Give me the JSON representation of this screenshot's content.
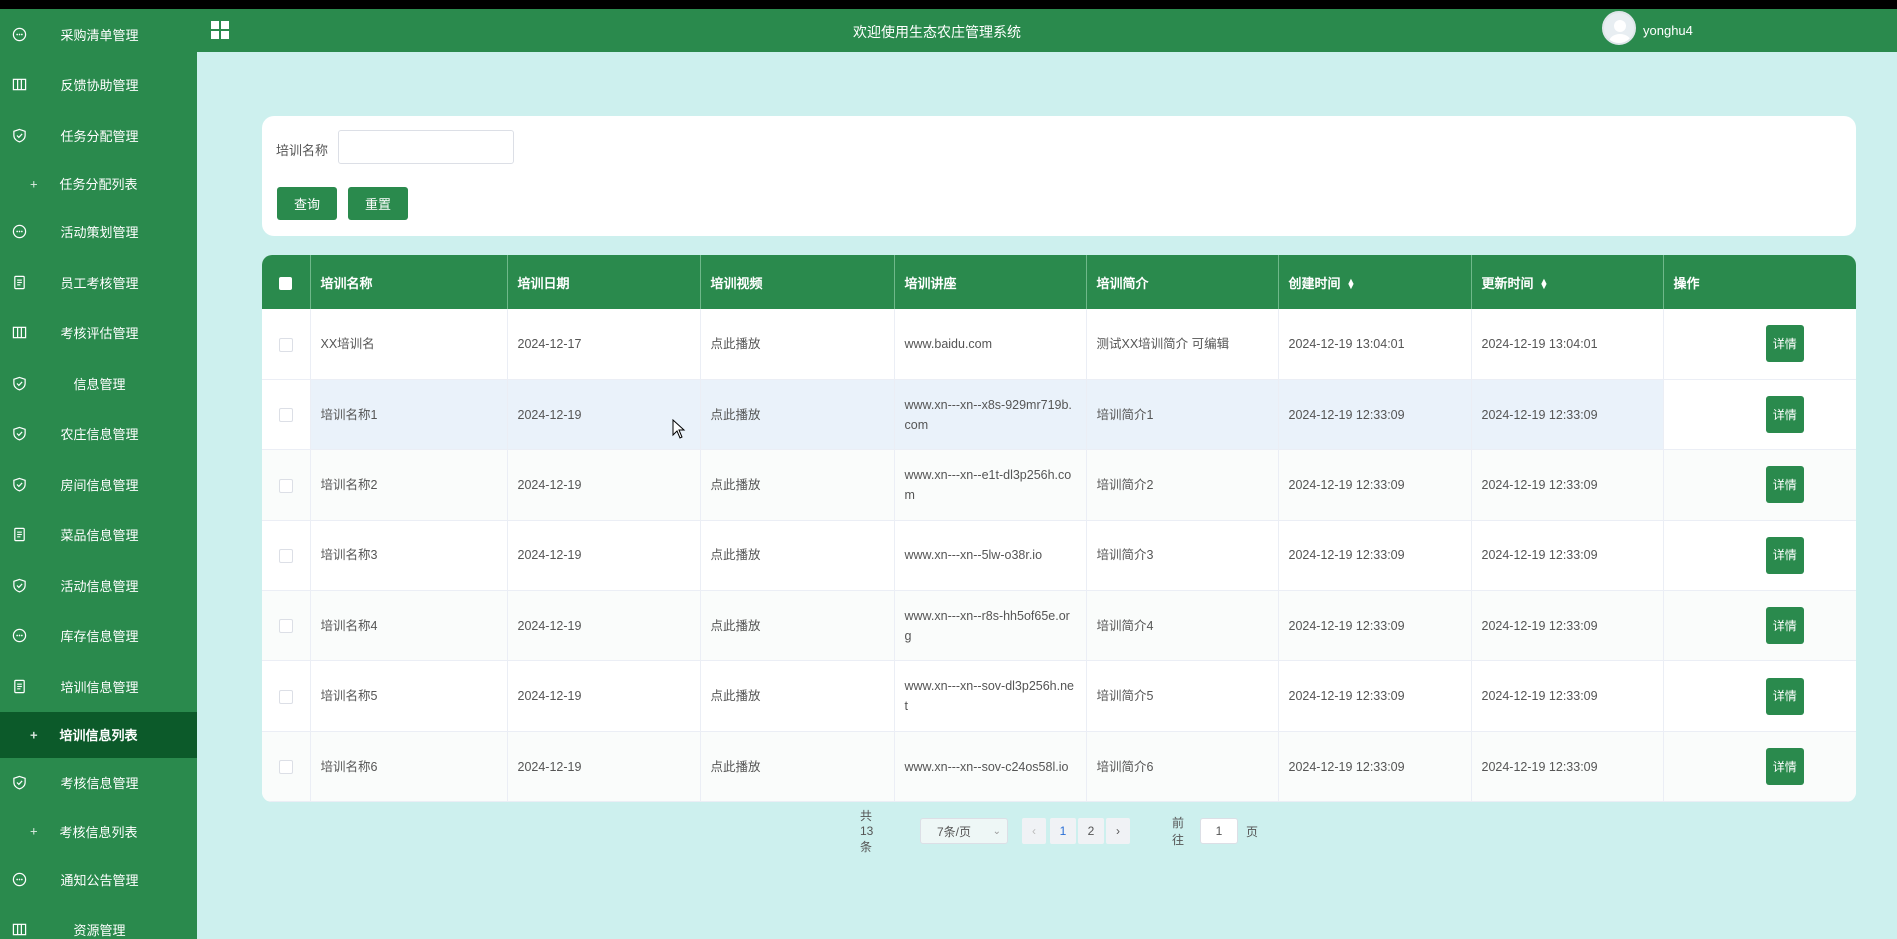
{
  "app": {
    "title": "欢迎使用生态农庄管理系统",
    "username": "yonghu4"
  },
  "sidebar": {
    "items": [
      {
        "label": "采购清单管理",
        "icon": "chat-icon",
        "type": "menu"
      },
      {
        "label": "反馈协助管理",
        "icon": "columns-icon",
        "type": "menu"
      },
      {
        "label": "任务分配管理",
        "icon": "shield-icon",
        "type": "menu"
      },
      {
        "label": "任务分配列表",
        "icon": "plus-icon",
        "type": "sub"
      },
      {
        "label": "活动策划管理",
        "icon": "chat-icon",
        "type": "menu"
      },
      {
        "label": "员工考核管理",
        "icon": "document-icon",
        "type": "menu"
      },
      {
        "label": "考核评估管理",
        "icon": "columns-icon",
        "type": "menu"
      },
      {
        "label": "信息管理",
        "icon": "shield-icon",
        "type": "menu"
      },
      {
        "label": "农庄信息管理",
        "icon": "shield-icon",
        "type": "menu"
      },
      {
        "label": "房间信息管理",
        "icon": "shield-icon",
        "type": "menu"
      },
      {
        "label": "菜品信息管理",
        "icon": "document-icon",
        "type": "menu"
      },
      {
        "label": "活动信息管理",
        "icon": "shield-icon",
        "type": "menu"
      },
      {
        "label": "库存信息管理",
        "icon": "chat-icon",
        "type": "menu"
      },
      {
        "label": "培训信息管理",
        "icon": "document-icon",
        "type": "menu"
      },
      {
        "label": "培训信息列表",
        "icon": "plus-icon",
        "type": "sub",
        "active": true
      },
      {
        "label": "考核信息管理",
        "icon": "shield-icon",
        "type": "menu"
      },
      {
        "label": "考核信息列表",
        "icon": "plus-icon",
        "type": "sub"
      },
      {
        "label": "通知公告管理",
        "icon": "chat-icon",
        "type": "menu"
      },
      {
        "label": "资源管理",
        "icon": "columns-icon",
        "type": "menu"
      }
    ]
  },
  "search": {
    "label": "培训名称",
    "value": "",
    "query_label": "查询",
    "reset_label": "重置"
  },
  "table": {
    "columns": [
      "培训名称",
      "培训日期",
      "培训视频",
      "培训讲座",
      "培训简介",
      "创建时间",
      "更新时间",
      "操作"
    ],
    "rows": [
      [
        "XX培训名",
        "2024-12-17",
        "点此播放",
        "www.baidu.com",
        "测试XX培训简介 可编辑",
        "2024-12-19 13:04:01",
        "2024-12-19 13:04:01",
        "详情"
      ],
      [
        "培训名称1",
        "2024-12-19",
        "点此播放",
        "www.xn---xn--x8s-929mr719b.com",
        "培训简介1",
        "2024-12-19 12:33:09",
        "2024-12-19 12:33:09",
        "详情"
      ],
      [
        "培训名称2",
        "2024-12-19",
        "点此播放",
        "www.xn---xn--e1t-dl3p256h.com",
        "培训简介2",
        "2024-12-19 12:33:09",
        "2024-12-19 12:33:09",
        "详情"
      ],
      [
        "培训名称3",
        "2024-12-19",
        "点此播放",
        "www.xn---xn--5lw-o38r.io",
        "培训简介3",
        "2024-12-19 12:33:09",
        "2024-12-19 12:33:09",
        "详情"
      ],
      [
        "培训名称4",
        "2024-12-19",
        "点此播放",
        "www.xn---xn--r8s-hh5of65e.org",
        "培训简介4",
        "2024-12-19 12:33:09",
        "2024-12-19 12:33:09",
        "详情"
      ],
      [
        "培训名称5",
        "2024-12-19",
        "点此播放",
        "www.xn---xn--sov-dl3p256h.net",
        "培训简介5",
        "2024-12-19 12:33:09",
        "2024-12-19 12:33:09",
        "详情"
      ],
      [
        "培训名称6",
        "2024-12-19",
        "点此播放",
        "www.xn---xn--sov-c24os58l.io",
        "培训简介6",
        "2024-12-19 12:33:09",
        "2024-12-19 12:33:09",
        "详情"
      ]
    ]
  },
  "pagination": {
    "total_label": "共 13 条",
    "page_size": "7条/页",
    "pages": [
      "1",
      "2"
    ],
    "current": "1",
    "goto_label": "前往",
    "goto_value": "1",
    "page_suffix": "页"
  },
  "colors": {
    "primary": "#2a8a4d",
    "active_menu": "#0c5a2a",
    "background": "#cdf0ee"
  }
}
